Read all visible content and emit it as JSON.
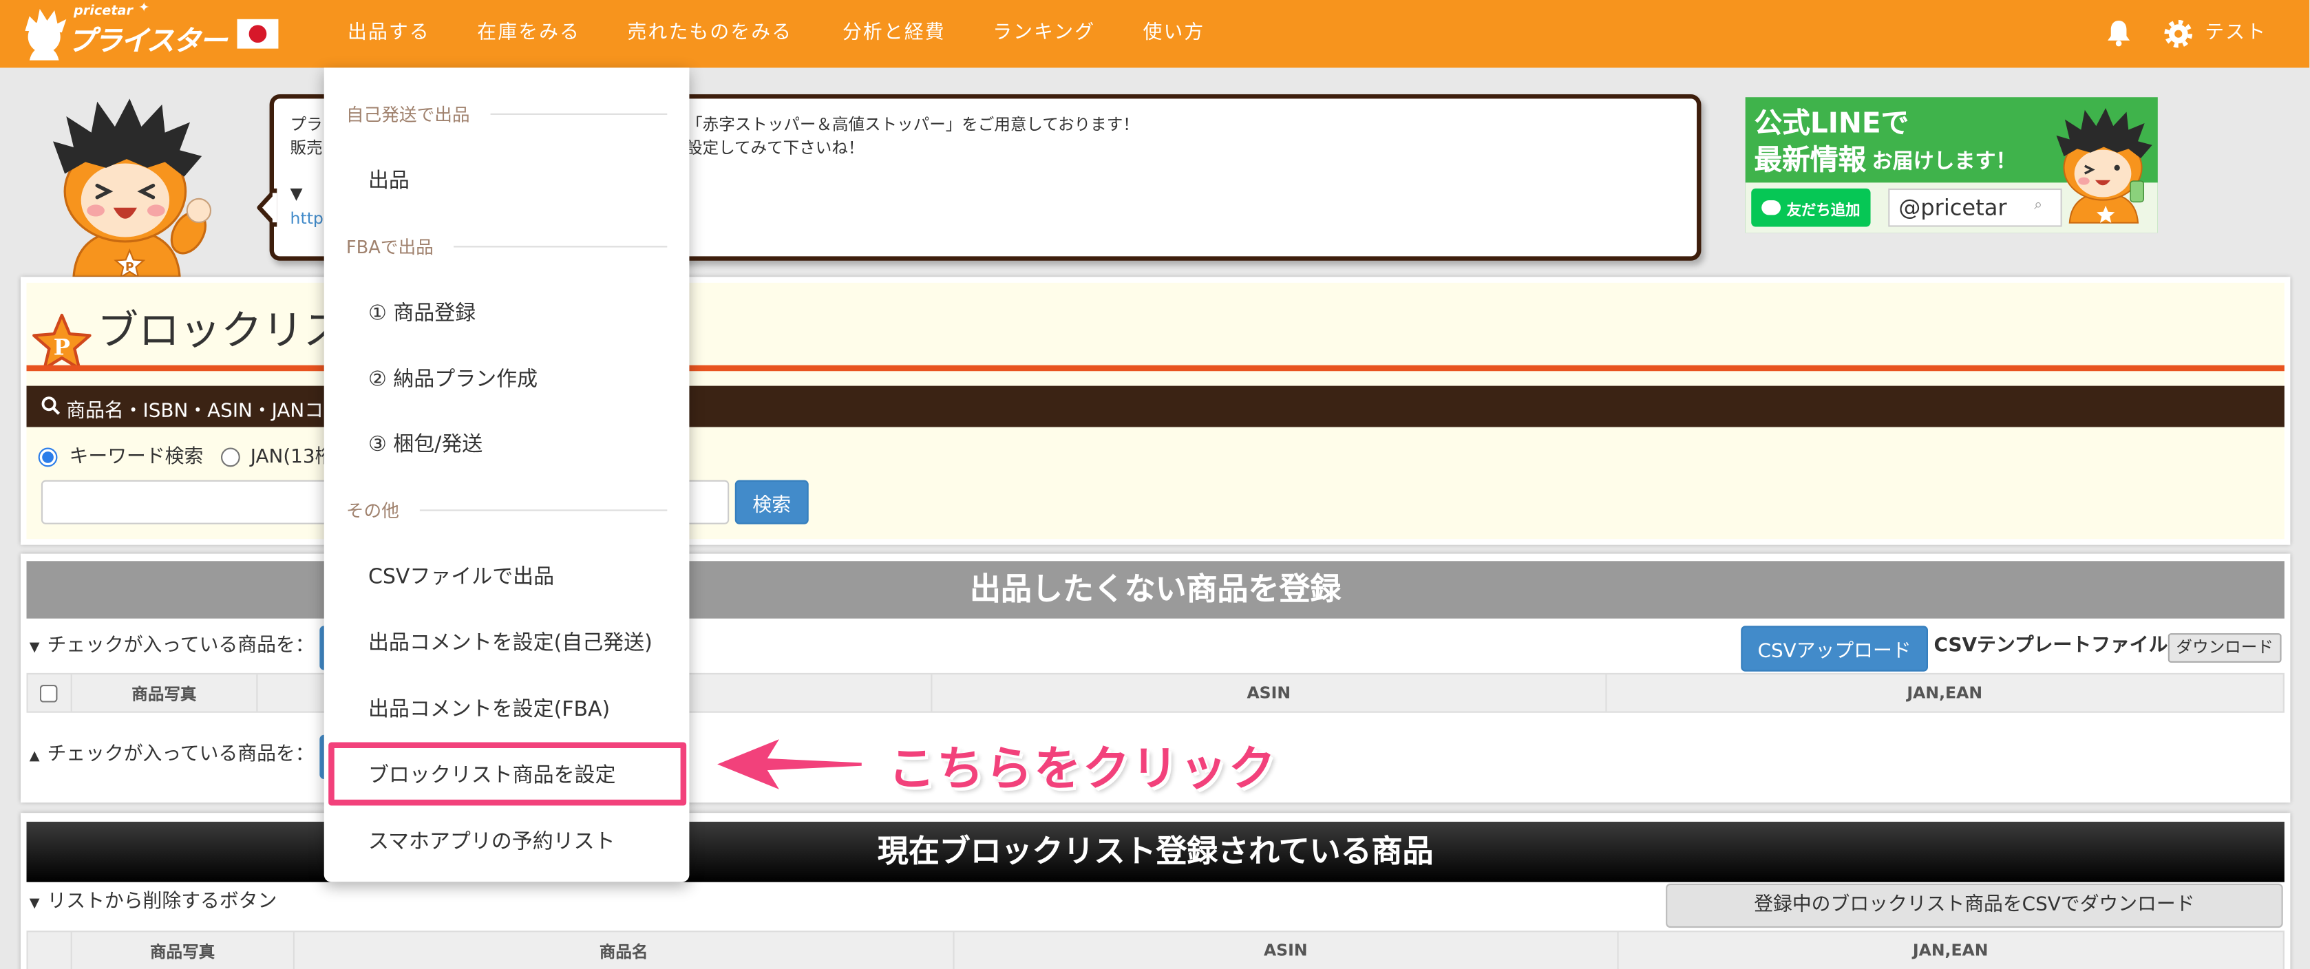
{
  "theme": {
    "brand": "#f7941d",
    "accent_pink": "#f2417b",
    "panel_brown": "#3b2314",
    "primary_blue": "#428bca"
  },
  "header": {
    "logo_small": "pricetar",
    "logo_main": "プライスター",
    "flag_icon": "japan-flag-icon",
    "nav": [
      {
        "label": "出品する"
      },
      {
        "label": "在庫をみる"
      },
      {
        "label": "売れたものをみる"
      },
      {
        "label": "分析と経費"
      },
      {
        "label": "ランキング"
      },
      {
        "label": "使い方"
      }
    ],
    "notification_icon": "bell-icon",
    "settings_icon": "gear-icon",
    "user_name": "テスト"
  },
  "notice": {
    "left_fragments": [
      "プラ",
      "販売",
      "▼",
      "http"
    ],
    "right_line1": "「赤字ストッパー＆高値ストッパー」をご用意しております！",
    "right_line2": "設定してみて下さいね！"
  },
  "line_banner": {
    "line1": "公式LINEで",
    "line2_big": "最新情報",
    "line2_small": "お届けします！",
    "add_friend": "友だち追加",
    "line_id": "@pricetar"
  },
  "search_panel": {
    "title": "ブロックリス",
    "search_bar_label": "商品名・ISBN・ASIN・JANコ",
    "radio_keyword": "キーワード検索",
    "radio_jan": "JAN(13桁",
    "keyword_selected": true,
    "search_input_value": "",
    "search_button": "検索"
  },
  "register_panel": {
    "title": "出品したくない商品を登録",
    "checked_action_top": "チェックが入っている商品を：",
    "checked_action_bottom": "チェックが入っている商品を：",
    "csv_upload": "CSVアップロード",
    "csv_template": "CSVテンプレートファイル",
    "download": "ダウンロード",
    "columns": [
      "商品写真",
      "ASIN",
      "JAN,EAN"
    ]
  },
  "blocklist_panel": {
    "title": "現在ブロックリスト登録されている商品",
    "remove_label": "リストから削除するボタン",
    "csv_download": "登録中のブロックリスト商品をCSVでダウンロード",
    "columns": [
      "商品写真",
      "商品名",
      "ASIN",
      "JAN,EAN"
    ]
  },
  "dropdown": {
    "sections": [
      {
        "header": "自己発送で出品",
        "items": [
          {
            "label": "出品"
          }
        ]
      },
      {
        "header": "FBAで出品",
        "items": [
          {
            "label": "① 商品登録"
          },
          {
            "label": "② 納品プラン作成"
          },
          {
            "label": "③ 梱包/発送"
          }
        ]
      },
      {
        "header": "その他",
        "items": [
          {
            "label": "CSVファイルで出品"
          },
          {
            "label": "出品コメントを設定(自己発送)"
          },
          {
            "label": "出品コメントを設定(FBA)"
          },
          {
            "label": "ブロックリスト商品を設定"
          },
          {
            "label": "スマホアプリの予約リスト"
          }
        ]
      }
    ]
  },
  "annotation": {
    "text": "こちらをクリック"
  }
}
